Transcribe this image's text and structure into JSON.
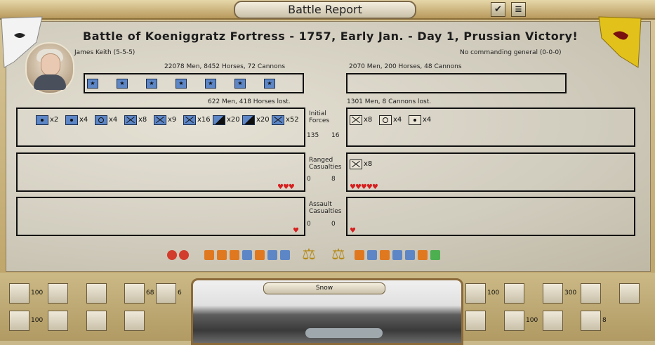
{
  "window": {
    "title": "Battle Report",
    "check_icon": "✔",
    "log_icon": "≣"
  },
  "heading": "Battle of Koeniggratz Fortress - 1757, Early Jan. - Day 1, Prussian Victory!",
  "left": {
    "commander": "James Keith (5-5-5)",
    "totals": "22078 Men, 8452 Horses, 72 Cannons",
    "stars": [
      "★",
      "★",
      "★",
      "★",
      "★",
      "★",
      "★"
    ],
    "lost": "622 Men, 418 Horses lost.",
    "initial_units": [
      "x2",
      "x4",
      "x4",
      "x8",
      "x9",
      "x16",
      "x20",
      "x20",
      "x52"
    ],
    "initial_nums": [
      "135",
      "16"
    ],
    "ranged_nums": [
      "0",
      "8"
    ],
    "assault_nums": [
      "0",
      "0"
    ],
    "ranged_hearts": "♥♥♥",
    "assault_hearts": "♥",
    "reserve_counts": [
      "100",
      "68",
      "6",
      "100"
    ]
  },
  "right": {
    "commander": "No commanding general (0-0-0)",
    "totals": "2070 Men, 200 Horses, 48 Cannons",
    "lost": "1301 Men, 8 Cannons lost.",
    "initial_units": [
      "x8",
      "x4",
      "x4"
    ],
    "ranged_units": [
      "x8"
    ],
    "ranged_hearts": "♥♥♥♥♥",
    "assault_hearts": "♥",
    "reserve_counts": [
      "100",
      "300",
      "100",
      "8"
    ]
  },
  "labels": {
    "initial": "Initial Forces",
    "ranged": "Ranged Casualties",
    "assault": "Assault Casualties"
  },
  "terrain": {
    "weather": "Snow"
  },
  "colors": {
    "parchment": "#d9d4c6",
    "unit_blue": "#5d86c6",
    "heart_red": "#d62020",
    "frame_gold": "#b99e5f"
  }
}
